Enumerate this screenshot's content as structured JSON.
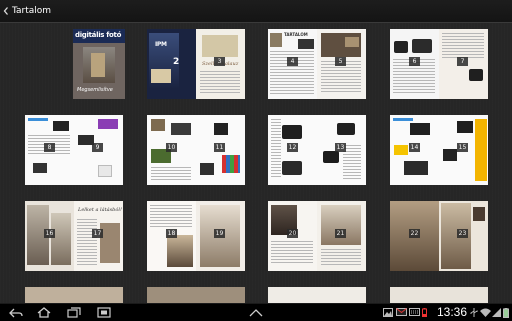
{
  "action_bar": {
    "title": "Tartalom",
    "back_icon": "chevron-left-icon"
  },
  "magazine": {
    "cover_logo": "digitális fotó",
    "cover_tag": "Megsemlisítve",
    "cover_flag_top": "IPM",
    "cover_flag_mid": "2",
    "contents_heading": "TARTALOM",
    "spread_title": "Szellemkalauz",
    "spread_title2": "Lelket a látásból!"
  },
  "pages": [
    {
      "thumb": 0,
      "number": ""
    },
    {
      "thumb": 1,
      "number": "2"
    },
    {
      "thumb": 1,
      "number": "3"
    },
    {
      "thumb": 2,
      "number": "4"
    },
    {
      "thumb": 2,
      "number": "5"
    },
    {
      "thumb": 3,
      "number": "6"
    },
    {
      "thumb": 3,
      "number": "7"
    },
    {
      "thumb": 4,
      "number": "8"
    },
    {
      "thumb": 4,
      "number": "9"
    },
    {
      "thumb": 5,
      "number": "10"
    },
    {
      "thumb": 5,
      "number": "11"
    },
    {
      "thumb": 6,
      "number": "12"
    },
    {
      "thumb": 6,
      "number": "13"
    },
    {
      "thumb": 7,
      "number": "14"
    },
    {
      "thumb": 7,
      "number": "15"
    },
    {
      "thumb": 8,
      "number": "16"
    },
    {
      "thumb": 8,
      "number": "17"
    },
    {
      "thumb": 9,
      "number": "18"
    },
    {
      "thumb": 9,
      "number": "19"
    },
    {
      "thumb": 10,
      "number": "20"
    },
    {
      "thumb": 10,
      "number": "21"
    },
    {
      "thumb": 11,
      "number": "22"
    },
    {
      "thumb": 11,
      "number": "23"
    }
  ],
  "nav_bar": {
    "back_icon": "back-icon",
    "home_icon": "home-icon",
    "recent_apps_icon": "recent-apps-icon",
    "screenshot_icon": "screenshot-icon",
    "up_icon": "chevron-up-icon"
  },
  "status_bar": {
    "time": "13:36",
    "icons": [
      "gallery-icon",
      "gmail-icon",
      "keyboard-icon",
      "battery-low-icon",
      "usb-icon",
      "wifi-icon",
      "signal-icon",
      "battery-icon"
    ]
  }
}
